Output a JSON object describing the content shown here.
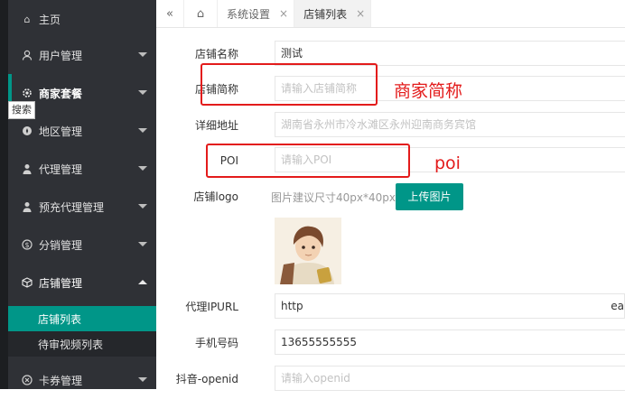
{
  "sidebar": {
    "items": [
      {
        "label": "主页",
        "icon": "home-icon"
      },
      {
        "label": "用户管理",
        "icon": "user-icon"
      },
      {
        "label": "商家套餐",
        "icon": "settings-icon"
      },
      {
        "label": "地区管理",
        "icon": "compass-icon"
      },
      {
        "label": "代理管理",
        "icon": "person-icon"
      },
      {
        "label": "预充代理管理",
        "icon": "person-icon"
      },
      {
        "label": "分销管理",
        "icon": "dollar-circle-icon"
      },
      {
        "label": "店铺管理",
        "icon": "cube-icon"
      },
      {
        "label": "卡券管理",
        "icon": "ticket-icon"
      }
    ],
    "subitems": [
      {
        "label": "店铺列表",
        "active": true
      },
      {
        "label": "待审视频列表",
        "active": false
      }
    ],
    "tooltip": "搜索"
  },
  "tabbar": {
    "tabs": [
      {
        "label": "系统设置",
        "close": "×"
      },
      {
        "label": "店铺列表",
        "close": "×",
        "active": true
      }
    ]
  },
  "form": {
    "shop_name": {
      "label": "店铺名称",
      "value": "测试"
    },
    "shop_abbr": {
      "label": "店铺简称",
      "placeholder": "请输入店铺简称"
    },
    "address": {
      "label": "详细地址",
      "placeholder": "湖南省永州市冷水滩区永州迎南商务宾馆"
    },
    "poi": {
      "label": "POI",
      "placeholder": "请输入POI"
    },
    "logo": {
      "label": "店铺logo",
      "hint": "图片建议尺寸40px*40px",
      "button": "上传图片"
    },
    "proxy_url": {
      "label": "代理IPURL",
      "value": "http",
      "tail": "ea"
    },
    "phone": {
      "label": "手机号码",
      "value": "13655555555"
    },
    "douyin_openid": {
      "label": "抖音-openid",
      "placeholder": "请输入openid"
    }
  },
  "annotations": {
    "shop_abbr_note": "商家简称",
    "poi_note": "poi"
  },
  "colors": {
    "accent": "#009688",
    "sidebar_bg": "#2f3136",
    "annotation": "#e31b1b"
  }
}
